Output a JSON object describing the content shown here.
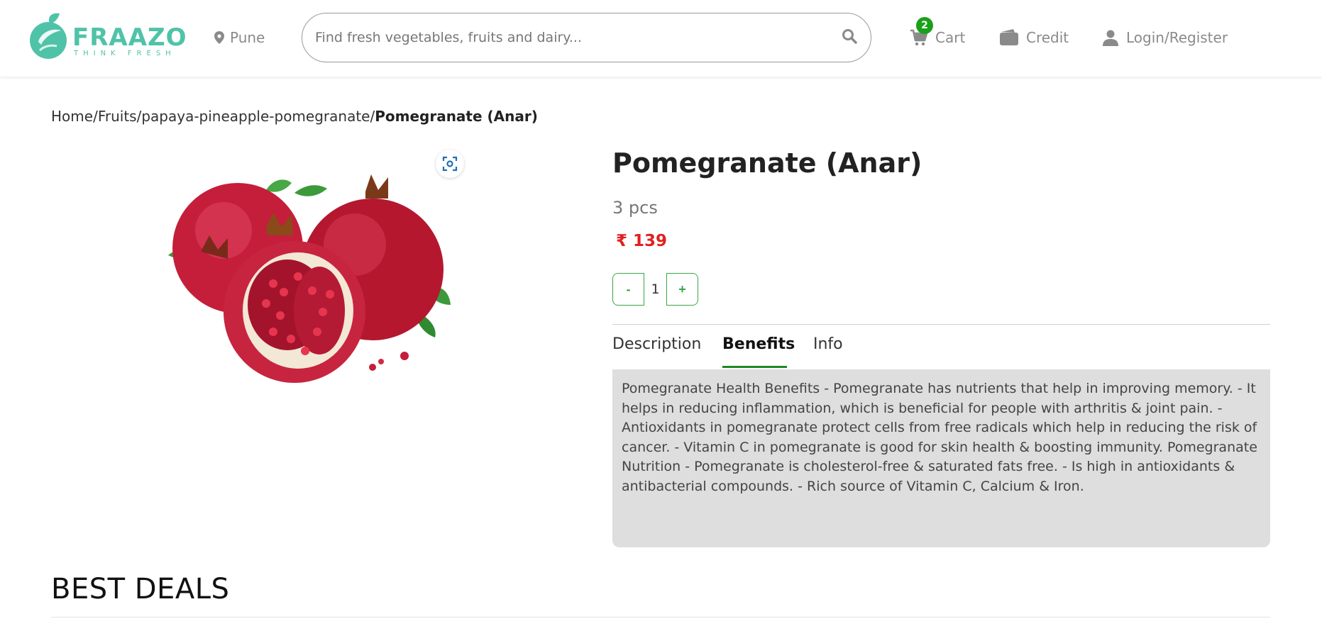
{
  "header": {
    "logo_text": "FRAAZO",
    "logo_tagline": "THINK FRESH",
    "location": "Pune",
    "search_placeholder": "Find fresh vegetables, fruits and dairy...",
    "cart_label": "Cart",
    "cart_count": "2",
    "credit_label": "Credit",
    "login_label": "Login/Register"
  },
  "breadcrumb": [
    {
      "label": "Home",
      "sep": "/"
    },
    {
      "label": "Fruits",
      "sep": "/"
    },
    {
      "label": "papaya-pineapple-pomegranate",
      "sep": "/"
    },
    {
      "label": "Pomegranate (Anar)",
      "sep": ""
    }
  ],
  "product": {
    "title": "Pomegranate (Anar)",
    "quantity_unit": "3 pcs",
    "price": "₹ 139",
    "qty_minus": "-",
    "qty_value": "1",
    "qty_plus": "+"
  },
  "tabs": [
    {
      "label": "Description",
      "active": false
    },
    {
      "label": "Benefits",
      "active": true
    },
    {
      "label": "Info",
      "active": false
    }
  ],
  "benefits_text": "Pomegranate Health Benefits - Pomegranate has nutrients that help in improving memory. - It helps in reducing inflammation, which is beneficial for people with arthritis & joint pain. - Antioxidants in pomegranate protect cells from free radicals which help in reducing the risk of cancer. - Vitamin C in pomegranate is good for skin health & boosting immunity. Pomegranate Nutrition - Pomegranate is cholesterol-free & saturated fats free. - Is high in antioxidants & antibacterial compounds. - Rich source of Vitamin C, Calcium & Iron.",
  "sections": {
    "best_deals_title": "BEST DEALS"
  },
  "colors": {
    "brand": "#4fc3a8",
    "accent_green": "#1e8a1e",
    "price_red": "#e02020",
    "panel_bg": "#dedede"
  },
  "icons": {
    "location": "location-pin-icon",
    "search": "search-icon",
    "cart": "cart-icon",
    "credit": "wallet-icon",
    "login": "user-icon",
    "zoom": "zoom-icon"
  }
}
